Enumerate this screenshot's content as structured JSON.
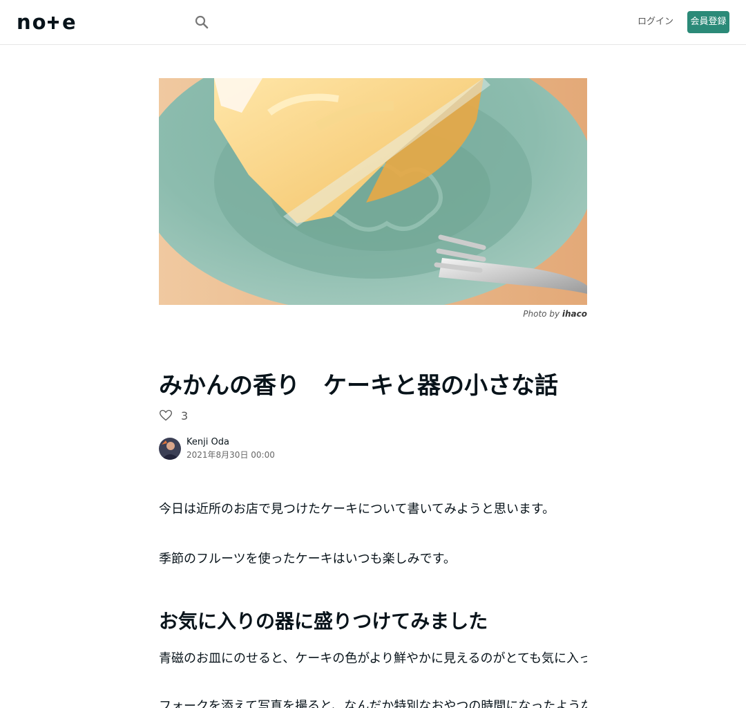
{
  "header": {
    "logo_text": "note",
    "login_label": "ログイン",
    "signup_label": "会員登録"
  },
  "eyecatch": {
    "credit_prefix": "Photo by",
    "credit_name": "ihaco"
  },
  "article": {
    "title": "みかんの香り　ケーキと器の小さな話",
    "like_count": "3",
    "author_name": "Kenji Oda",
    "date": "2021年8月30日 00:00",
    "paragraphs": [
      "今日は近所のお店で見つけたケーキについて書いてみようと思います。",
      "季節のフルーツを使ったケーキはいつも楽しみです。",
      "お気に入りの器に盛りつけてみました",
      "青磁のお皿にのせると、ケーキの色がより鮮やかに見えるのがとても気に入っています。",
      "フォークを添えて写真を撮ると、なんだか特別なおやつの時間になったような気がして、少し嬉しくなります。これからも"
    ]
  },
  "colors": {
    "brand": "#2b8a78",
    "text": "#08131a"
  }
}
